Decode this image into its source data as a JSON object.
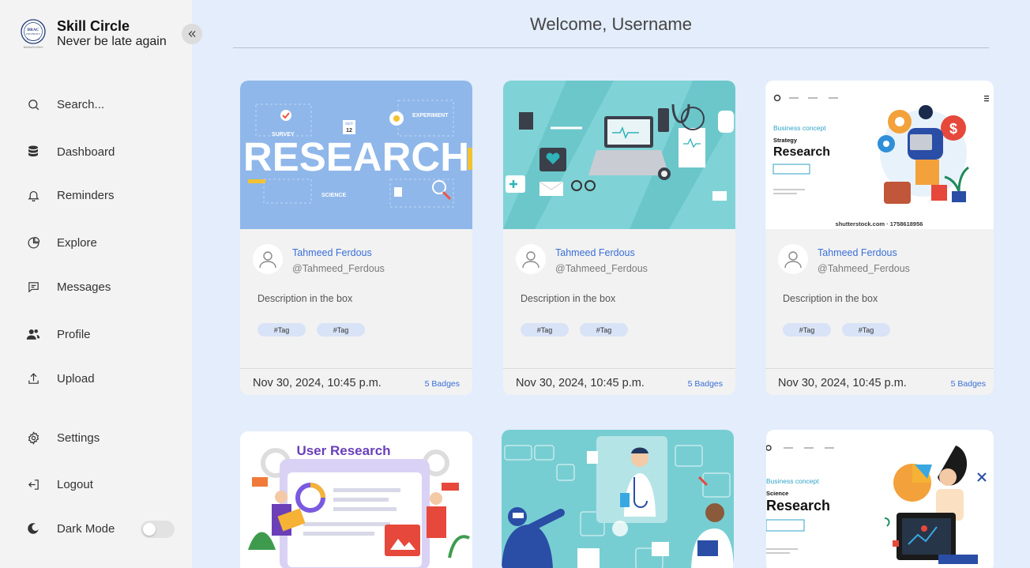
{
  "brand": {
    "title": "Skill Circle",
    "subtitle": "Never be late again",
    "logo_text": "BRAC UNIVERSITY",
    "logo_tagline": "Inspiring Excellence"
  },
  "nav": {
    "search": "Search...",
    "dashboard": "Dashboard",
    "reminders": "Reminders",
    "explore": "Explore",
    "messages": "Messages",
    "profile": "Profile",
    "upload": "Upload",
    "settings": "Settings",
    "logout": "Logout",
    "dark_mode": "Dark Mode"
  },
  "dark_mode_on": false,
  "header": {
    "welcome": "Welcome, Username"
  },
  "cards": [
    {
      "author": "Tahmeed Ferdous",
      "handle": "@Tahmeed_Ferdous",
      "description": "Description in the box",
      "tags": [
        "#Tag",
        "#Tag"
      ],
      "date": "Nov 30, 2024, 10:45  p.m.",
      "badges": "5 Badges",
      "image": {
        "theme": "research-banner",
        "headline": "RESEARCH",
        "labels": [
          "SURVEY",
          "EXPERIMENT",
          "SCIENCE",
          "OCT",
          "12"
        ]
      }
    },
    {
      "author": "Tahmeed Ferdous",
      "handle": "@Tahmeed_Ferdous",
      "description": "Description in the box",
      "tags": [
        "#Tag",
        "#Tag"
      ],
      "date": "Nov 30, 2024, 10:45  p.m.",
      "badges": "5 Badges",
      "image": {
        "theme": "medical-flatlay"
      }
    },
    {
      "author": "Tahmeed Ferdous",
      "handle": "@Tahmeed_Ferdous",
      "description": "Description in the box",
      "tags": [
        "#Tag",
        "#Tag"
      ],
      "date": "Nov 30, 2024, 10:45  p.m.",
      "badges": "5 Badges",
      "image": {
        "theme": "business-research",
        "small": "Business concept",
        "strategy": "Strategy",
        "headline": "Research",
        "credit": "shutterstock.com · 1758618956"
      }
    },
    {
      "image": {
        "theme": "user-research",
        "headline": "User Research"
      }
    },
    {
      "image": {
        "theme": "medical-research"
      }
    },
    {
      "image": {
        "theme": "science-research",
        "small": "Business concept",
        "strategy": "Science",
        "headline": "Research"
      }
    }
  ],
  "colors": {
    "page_bg": "#e3edfb",
    "sidebar_bg": "#f3f3f3",
    "link": "#3a6fd8",
    "tag_bg": "#d8e3f7",
    "thumb_blue": "#8fb7ea",
    "thumb_teal": "#7fd3d6"
  }
}
